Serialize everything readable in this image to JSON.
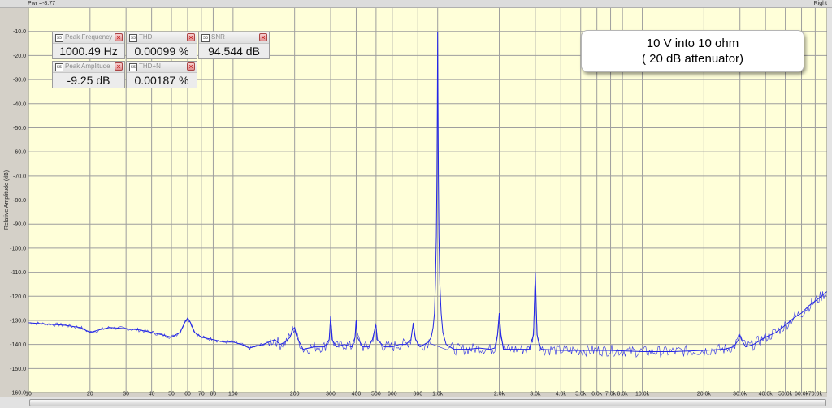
{
  "header": {
    "power_readout": "Pwr =-8.77",
    "channel": "Right"
  },
  "widgets": [
    {
      "title": "Peak Frequency",
      "value": "1000.49 Hz"
    },
    {
      "title": "THD",
      "value": "0.00099 %"
    },
    {
      "title": "SNR",
      "value": "94.544 dB"
    },
    {
      "title": "Peak Amplitude",
      "value": "-9.25 dB"
    },
    {
      "title": "THD+N",
      "value": "0.00187 %"
    }
  ],
  "widget_icon_text": "55",
  "note": {
    "line1": "10 V into 10 ohm",
    "line2": "( 20 dB attenuator)"
  },
  "colors": {
    "plot_bg": "#ffffd9",
    "grid": "#9e9e9e",
    "trace": "#2326e6",
    "outer": "#d4d0c8"
  },
  "chart_data": {
    "type": "line",
    "title": "",
    "xlabel": "",
    "ylabel": "Relative Amplitude (dB)",
    "x_scale": "log",
    "xlim": [
      10,
      80000
    ],
    "ylim": [
      -160,
      0
    ],
    "grid": true,
    "x_ticks": [
      10,
      20,
      30,
      40,
      50,
      60,
      70,
      80,
      100,
      200,
      300,
      400,
      500,
      600,
      800,
      1000,
      2000,
      3000,
      4000,
      5000,
      6000,
      7000,
      8000,
      10000,
      20000,
      30000,
      40000,
      50000,
      60000,
      70000
    ],
    "x_tick_labels": [
      "10",
      "20",
      "30",
      "40",
      "50",
      "60",
      "70",
      "80",
      "100",
      "200",
      "300",
      "400",
      "500",
      "600",
      "800",
      "1.0k",
      "2.0k",
      "3.0k",
      "4.0k",
      "5.0k",
      "6.0k",
      "7.0k",
      "8.0k",
      "10.0k",
      "20.0k",
      "30.0k",
      "40.0k",
      "50.0k",
      "60.0k",
      "70.0k"
    ],
    "y_ticks": [
      -10,
      -20,
      -30,
      -40,
      -50,
      -60,
      -70,
      -80,
      -90,
      -100,
      -110,
      -120,
      -130,
      -140,
      -150,
      -160
    ],
    "y_tick_labels": [
      "-10.0",
      "-20.0",
      "-30.0",
      "-40.0",
      "-50.0",
      "-60.0",
      "-70.0",
      "-80.0",
      "-90.0",
      "-100.0",
      "-110.0",
      "-120.0",
      "-130.0",
      "-140.0",
      "-150.0",
      "-160.0"
    ],
    "series": [
      {
        "color": "#2326e6",
        "points": [
          [
            10,
            -131
          ],
          [
            12,
            -131.5
          ],
          [
            15,
            -132
          ],
          [
            18,
            -133
          ],
          [
            20,
            -135
          ],
          [
            22,
            -134
          ],
          [
            25,
            -133
          ],
          [
            30,
            -133.5
          ],
          [
            35,
            -134
          ],
          [
            40,
            -135
          ],
          [
            45,
            -136
          ],
          [
            50,
            -137
          ],
          [
            55,
            -135
          ],
          [
            58,
            -131
          ],
          [
            60,
            -129
          ],
          [
            62,
            -131
          ],
          [
            65,
            -135
          ],
          [
            70,
            -137
          ],
          [
            80,
            -138
          ],
          [
            90,
            -139
          ],
          [
            100,
            -139
          ],
          [
            110,
            -140
          ],
          [
            120,
            -141.5
          ],
          [
            140,
            -140
          ],
          [
            150,
            -139
          ],
          [
            160,
            -138
          ],
          [
            170,
            -140
          ],
          [
            180,
            -139
          ],
          [
            190,
            -137
          ],
          [
            195,
            -134
          ],
          [
            200,
            -133
          ],
          [
            205,
            -137
          ],
          [
            220,
            -142
          ],
          [
            250,
            -141
          ],
          [
            280,
            -141
          ],
          [
            295,
            -138
          ],
          [
            300,
            -128
          ],
          [
            305,
            -138
          ],
          [
            320,
            -141
          ],
          [
            350,
            -140
          ],
          [
            380,
            -141
          ],
          [
            395,
            -137
          ],
          [
            400,
            -130
          ],
          [
            405,
            -137
          ],
          [
            430,
            -141
          ],
          [
            460,
            -141
          ],
          [
            480,
            -138
          ],
          [
            495,
            -133
          ],
          [
            500,
            -132
          ],
          [
            505,
            -138
          ],
          [
            550,
            -141
          ],
          [
            600,
            -141
          ],
          [
            650,
            -140
          ],
          [
            700,
            -140
          ],
          [
            740,
            -138
          ],
          [
            760,
            -131
          ],
          [
            780,
            -138
          ],
          [
            820,
            -141
          ],
          [
            860,
            -140
          ],
          [
            900,
            -139
          ],
          [
            930,
            -137
          ],
          [
            950,
            -133
          ],
          [
            965,
            -127
          ],
          [
            975,
            -115
          ],
          [
            985,
            -95
          ],
          [
            992,
            -70
          ],
          [
            996,
            -40
          ],
          [
            1000,
            -10
          ],
          [
            1004,
            -40
          ],
          [
            1008,
            -70
          ],
          [
            1015,
            -95
          ],
          [
            1025,
            -115
          ],
          [
            1040,
            -127
          ],
          [
            1060,
            -135
          ],
          [
            1100,
            -140
          ],
          [
            1200,
            -142
          ],
          [
            1400,
            -142
          ],
          [
            1600,
            -141.5
          ],
          [
            1800,
            -142
          ],
          [
            1900,
            -141.5
          ],
          [
            1960,
            -136
          ],
          [
            2000,
            -127
          ],
          [
            2040,
            -136
          ],
          [
            2100,
            -142
          ],
          [
            2400,
            -142
          ],
          [
            2800,
            -142
          ],
          [
            2940,
            -136
          ],
          [
            3000,
            -110
          ],
          [
            3060,
            -136
          ],
          [
            3200,
            -142
          ],
          [
            4000,
            -142.5
          ],
          [
            5000,
            -142.5
          ],
          [
            7000,
            -142.5
          ],
          [
            10000,
            -143
          ],
          [
            14000,
            -143
          ],
          [
            20000,
            -142.5
          ],
          [
            25000,
            -142
          ],
          [
            28000,
            -141
          ],
          [
            29500,
            -138
          ],
          [
            30000,
            -136
          ],
          [
            30500,
            -138
          ],
          [
            32000,
            -141
          ],
          [
            35000,
            -140
          ],
          [
            40000,
            -137
          ],
          [
            45000,
            -135
          ],
          [
            50000,
            -132
          ],
          [
            55000,
            -129
          ],
          [
            60000,
            -127
          ],
          [
            65000,
            -124
          ],
          [
            70000,
            -122
          ],
          [
            75000,
            -120
          ],
          [
            80000,
            -118
          ]
        ]
      }
    ]
  }
}
